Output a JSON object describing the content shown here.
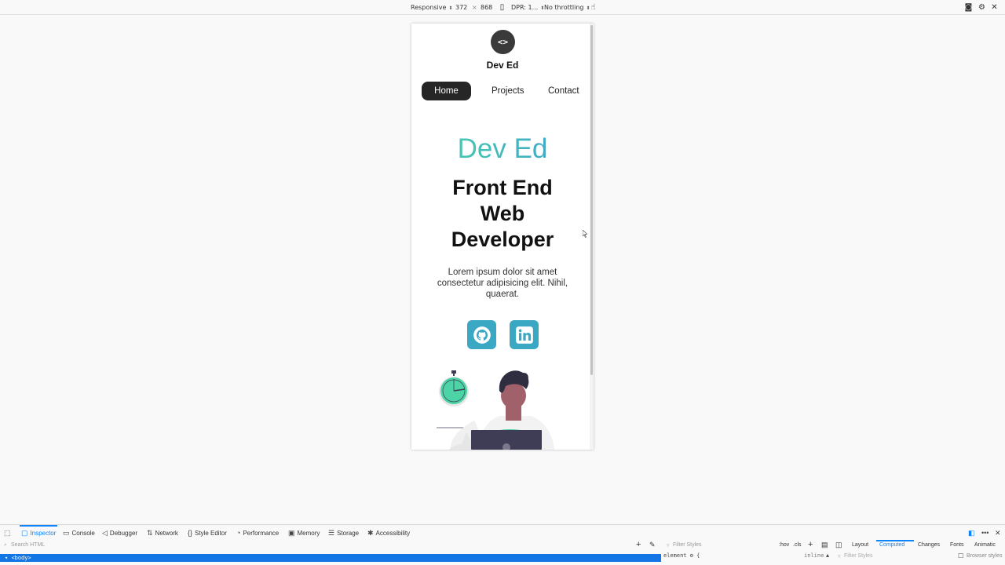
{
  "rdm_toolbar": {
    "mode": "Responsive",
    "width": "372",
    "times": "×",
    "height": "868",
    "dpr": "DPR: 1...",
    "throttling": "No throttling"
  },
  "site": {
    "logo_text": "<>",
    "brand": "Dev Ed",
    "nav": {
      "home": "Home",
      "projects": "Projects",
      "contact": "Contact"
    },
    "hero_name": "Dev Ed",
    "hero_title_lines": [
      "Front End",
      "Web",
      "Developer"
    ],
    "hero_desc": "Lorem ipsum dolor sit amet consectetur adipisicing elit. Nihil, quaerat.",
    "colors": {
      "gradient_start": "#4cd3a6",
      "gradient_end": "#3b9fd0",
      "social_bg": "#3aa8c2",
      "nav_active_bg": "#262626"
    }
  },
  "devtools": {
    "tabs": [
      "Inspector",
      "Console",
      "Debugger",
      "Network",
      "Style Editor",
      "Performance",
      "Memory",
      "Storage",
      "Accessibility"
    ],
    "search_placeholder": "Search HTML",
    "filter_styles": "Filter Styles",
    "hov": ":hov",
    "cls": ".cls",
    "side_tabs": [
      "Layout",
      "Computed",
      "Changes",
      "Fonts",
      "Animatic"
    ],
    "filter_styles_2": "Filter Styles",
    "browser_styles": "Browser styles",
    "element_rule": "element ⚙ {",
    "inline": "inline",
    "body_node": "<body>"
  }
}
